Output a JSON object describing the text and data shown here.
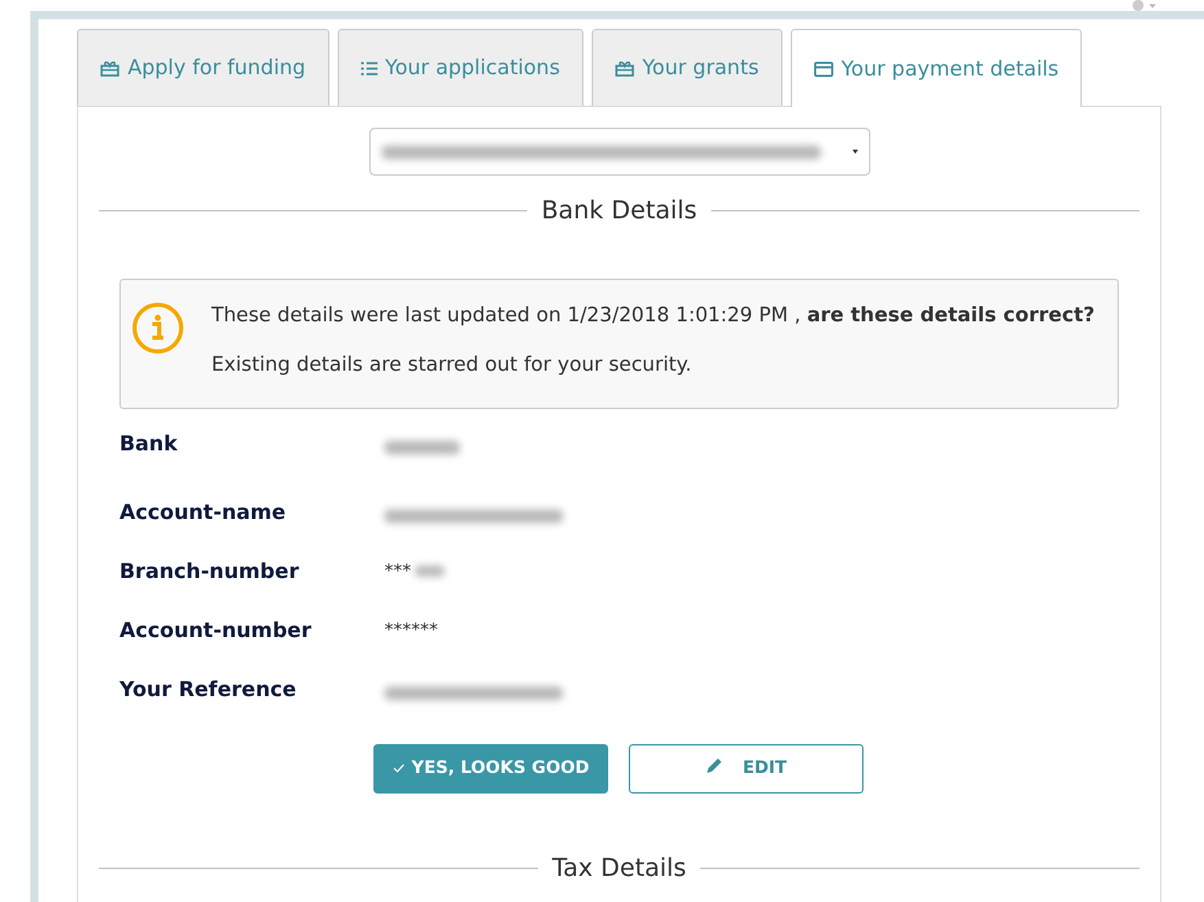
{
  "tabs": [
    {
      "label": "Apply for funding",
      "kind": "gift",
      "selected": false
    },
    {
      "label": "Your applications",
      "kind": "list",
      "selected": false
    },
    {
      "label": "Your grants",
      "kind": "gift",
      "selected": false
    },
    {
      "label": "Your payment details",
      "kind": "card",
      "selected": true
    }
  ],
  "account_select": {
    "kind": "blurred"
  },
  "sections": [
    {
      "title": "Bank Details"
    },
    {
      "title": "Tax Details"
    }
  ],
  "notice": {
    "message": "These details were last updated on 1/23/2018 1:01:29 PM , **are these details correct?**",
    "note": "Existing details are starred out for your security."
  },
  "fields": [
    {
      "label": "Bank",
      "kind": "blurred"
    },
    {
      "label": "Account-name",
      "kind": "blurred"
    },
    {
      "label": "Branch-number",
      "kind": "partial",
      "value": "***"
    },
    {
      "label": "Account-number",
      "kind": "text",
      "value": "******"
    },
    {
      "label": "Your Reference",
      "kind": "blurred"
    }
  ],
  "buttons": [
    {
      "label": "YES, LOOKS GOOD",
      "kind": "primary"
    },
    {
      "label": "EDIT",
      "kind": "secondary"
    }
  ]
}
